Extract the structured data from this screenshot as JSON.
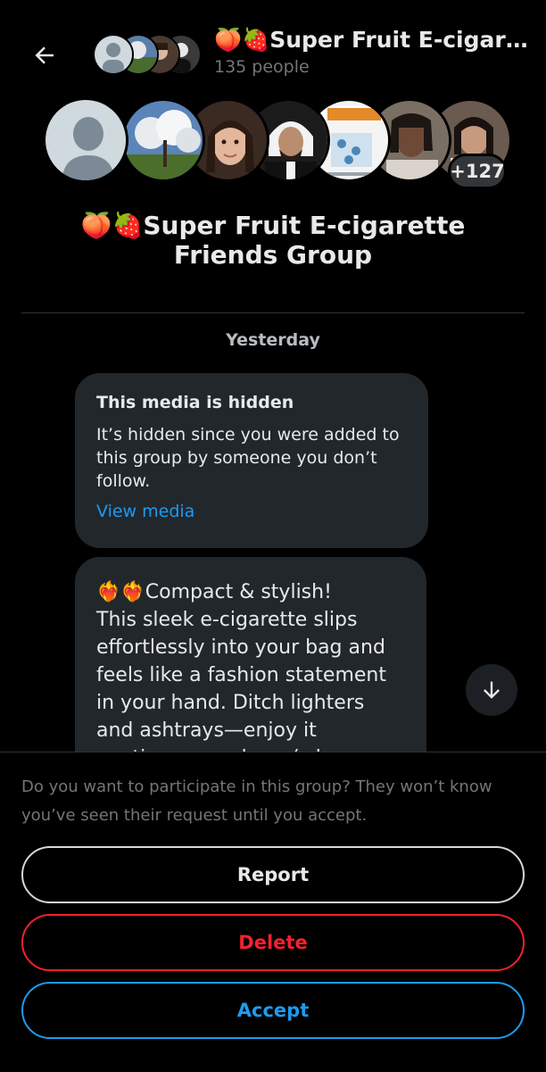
{
  "header": {
    "title": "🍑🍓Super Fruit E-cigarette Friends Group",
    "member_count": "135 people"
  },
  "avatars": {
    "more_badge": "+127"
  },
  "group_name": "🍑🍓Super Fruit E-cigarette Friends Group",
  "date_separator": "Yesterday",
  "hidden_media": {
    "title": "This media is hidden",
    "description": "It’s hidden since you were added to this group by someone you don’t follow.",
    "link": "View media"
  },
  "message": {
    "text": "❤️‍🔥❤️‍🔥Compact & stylish!\nThis sleek e-cigarette slips effortlessly into your bag and feels like a fashion statement in your hand. Ditch lighters and ashtrays—enjoy it anytime, anywhere (where permitted)."
  },
  "request": {
    "prompt": "Do you want to participate in this group? They won’t know you’ve seen their request until you accept.",
    "report_label": "Report",
    "delete_label": "Delete",
    "accept_label": "Accept"
  },
  "colors": {
    "accent": "#1d9bf0",
    "danger": "#f4212e",
    "bubble": "#22272c"
  }
}
